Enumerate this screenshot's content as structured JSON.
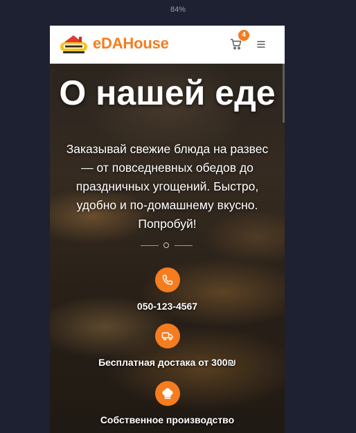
{
  "zoom_level": "84%",
  "header": {
    "brand": "eDAHouse",
    "logo_icon": "house-logo-icon",
    "cart_count": "4"
  },
  "hero": {
    "title": "О нашей еде",
    "description": "Заказывай свежие блюда на развес — от повседневных обедов до праздничных угощений. Быстро, удобно и по-домашнему вкусно. Попробуй!"
  },
  "features": [
    {
      "icon": "phone-icon",
      "label": "050-123-4567"
    },
    {
      "icon": "delivery-truck-icon",
      "label": "Бесплатная достака от 300₪"
    },
    {
      "icon": "chef-hat-icon",
      "label": "Собственное производство"
    }
  ],
  "colors": {
    "accent": "#f57c1f",
    "page_bg": "#1d2132",
    "header_bg": "#ffffff"
  }
}
